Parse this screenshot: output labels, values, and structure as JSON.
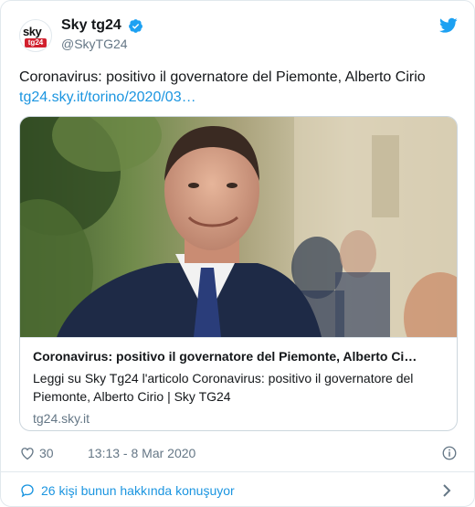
{
  "account": {
    "display_name": "Sky tg24",
    "handle": "@SkyTG24",
    "avatar_logo_top": "sky",
    "avatar_logo_bottom": "tg24"
  },
  "tweet": {
    "text": "Coronavirus: positivo il governatore del Piemonte, Alberto Cirio",
    "link": "tg24.sky.it/torino/2020/03…"
  },
  "card": {
    "title": "Coronavirus: positivo il governatore del Piemonte, Alberto Ci…",
    "description": "Leggi su Sky Tg24 l'articolo Coronavirus: positivo il governatore del Piemonte, Alberto Cirio | Sky TG24",
    "domain": "tg24.sky.it"
  },
  "meta": {
    "likes": "30",
    "timestamp": "13:13 - 8 Mar 2020"
  },
  "footer": {
    "conversation_label": "26 kişi bunun hakkında konuşuyor"
  },
  "icons": {
    "verified": "verified-badge-icon",
    "twitter": "twitter-bird-icon",
    "like": "heart-icon",
    "info": "info-icon",
    "conversation": "chat-bubble-icon",
    "chevron": "chevron-right-icon"
  },
  "colors": {
    "accent": "#1b95e0",
    "verified": "#1da1f2",
    "secondary_text": "#657786",
    "brand_red": "#d1202e"
  }
}
